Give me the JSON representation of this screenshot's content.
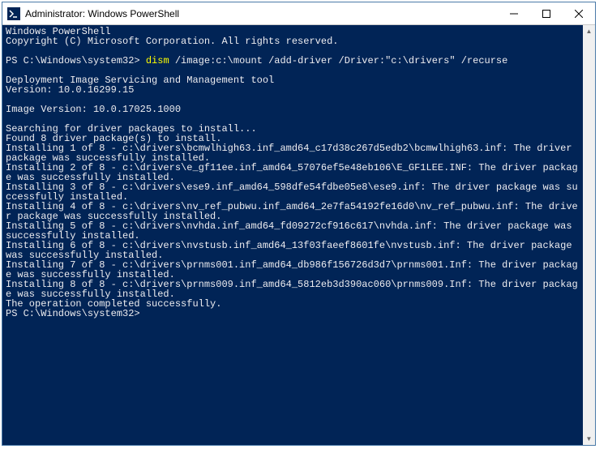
{
  "window": {
    "title": "Administrator: Windows PowerShell"
  },
  "console": {
    "header1": "Windows PowerShell",
    "header2": "Copyright (C) Microsoft Corporation. All rights reserved.",
    "prompt": "PS C:\\Windows\\system32>",
    "cmd_highlight": "dism",
    "cmd_rest": " /image:c:\\mount /add-driver /Driver:\"c:\\drivers\" /recurse",
    "body": "Deployment Image Servicing and Management tool\nVersion: 10.0.16299.15\n\nImage Version: 10.0.17025.1000\n\nSearching for driver packages to install...\nFound 8 driver package(s) to install.\nInstalling 1 of 8 - c:\\drivers\\bcmwlhigh63.inf_amd64_c17d38c267d5edb2\\bcmwlhigh63.inf: The driver package was successfully installed.\nInstalling 2 of 8 - c:\\drivers\\e_gf11ee.inf_amd64_57076ef5e48eb106\\E_GF1LEE.INF: The driver package was successfully installed.\nInstalling 3 of 8 - c:\\drivers\\ese9.inf_amd64_598dfe54fdbe05e8\\ese9.inf: The driver package was successfully installed.\nInstalling 4 of 8 - c:\\drivers\\nv_ref_pubwu.inf_amd64_2e7fa54192fe16d0\\nv_ref_pubwu.inf: The driver package was successfully installed.\nInstalling 5 of 8 - c:\\drivers\\nvhda.inf_amd64_fd09272cf916c617\\nvhda.inf: The driver package was successfully installed.\nInstalling 6 of 8 - c:\\drivers\\nvstusb.inf_amd64_13f03faeef8601fe\\nvstusb.inf: The driver package was successfully installed.\nInstalling 7 of 8 - c:\\drivers\\prnms001.inf_amd64_db986f156726d3d7\\prnms001.Inf: The driver package was successfully installed.\nInstalling 8 of 8 - c:\\drivers\\prnms009.inf_amd64_5812eb3d390ac060\\prnms009.Inf: The driver package was successfully installed.\nThe operation completed successfully.",
    "prompt2": "PS C:\\Windows\\system32>"
  }
}
